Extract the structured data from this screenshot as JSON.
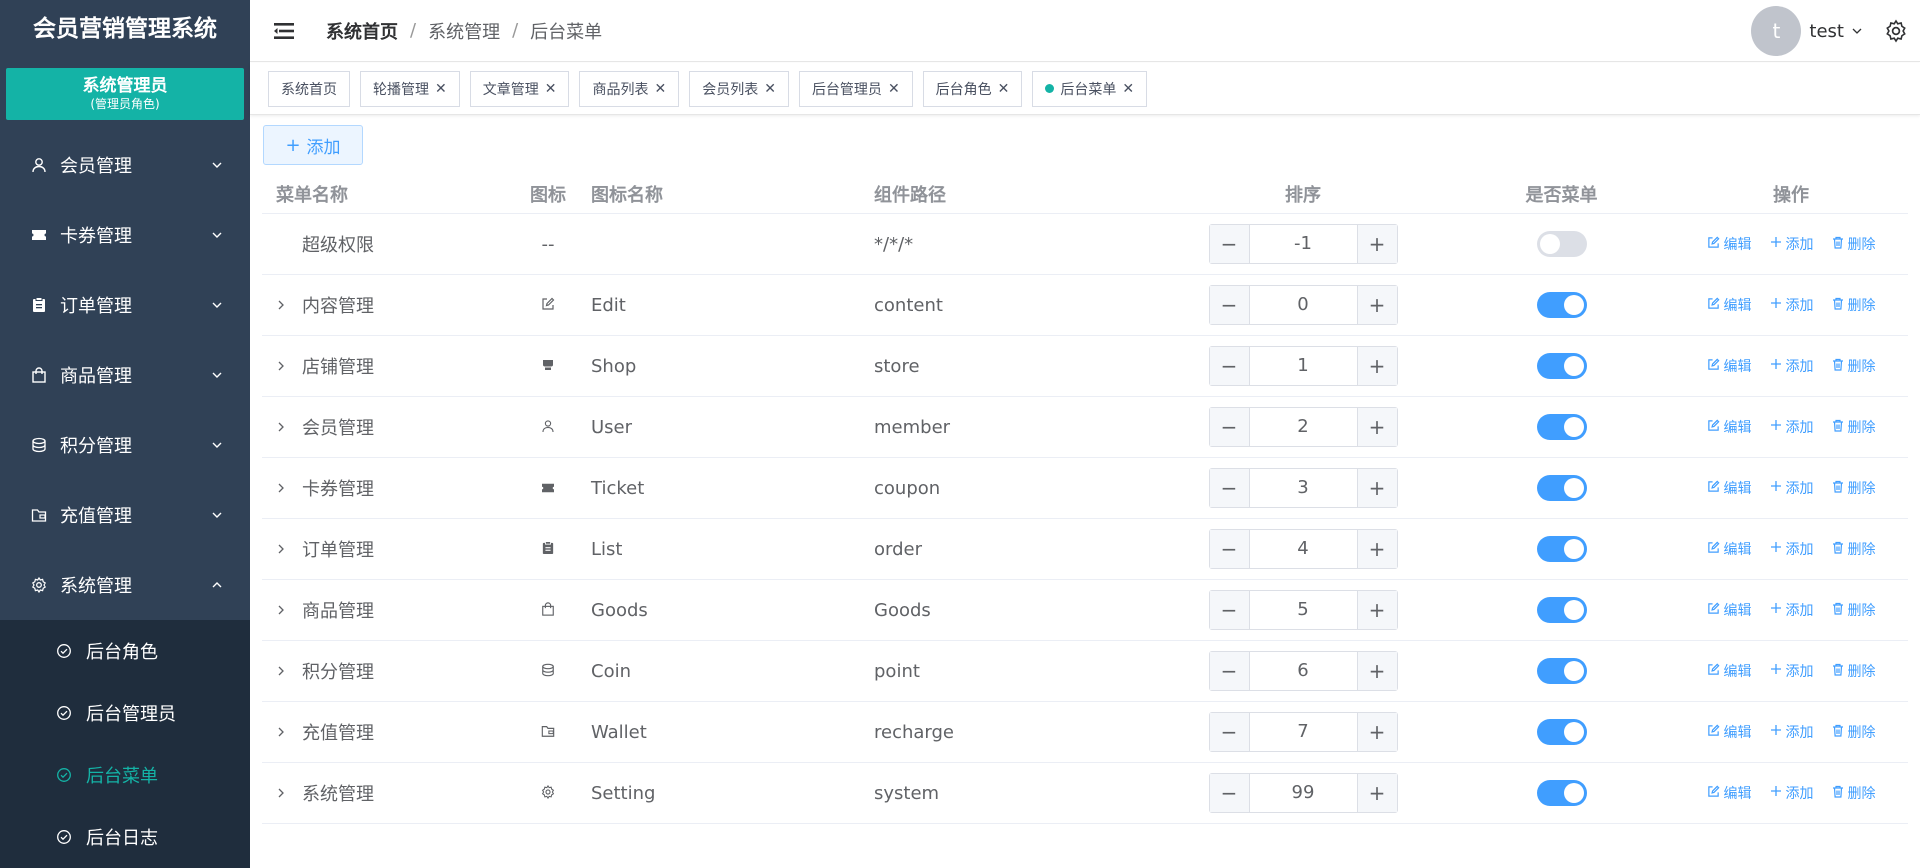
{
  "app_title": "会员营销管理系统",
  "role": {
    "name": "系统管理员",
    "sub": "(管理员角色)"
  },
  "sidebar": {
    "items": [
      {
        "label": "会员管理",
        "icon": "user-icon"
      },
      {
        "label": "卡券管理",
        "icon": "ticket-icon"
      },
      {
        "label": "订单管理",
        "icon": "list-icon"
      },
      {
        "label": "商品管理",
        "icon": "bag-icon"
      },
      {
        "label": "积分管理",
        "icon": "coin-icon"
      },
      {
        "label": "充值管理",
        "icon": "wallet-icon"
      },
      {
        "label": "系统管理",
        "icon": "gear-icon"
      }
    ],
    "subitems": [
      {
        "label": "后台角色"
      },
      {
        "label": "后台管理员"
      },
      {
        "label": "后台菜单"
      },
      {
        "label": "后台日志"
      }
    ]
  },
  "breadcrumb": [
    "系统首页",
    "系统管理",
    "后台菜单"
  ],
  "user": {
    "avatar": "t",
    "name": "test"
  },
  "tags": [
    {
      "label": "系统首页"
    },
    {
      "label": "轮播管理"
    },
    {
      "label": "文章管理"
    },
    {
      "label": "商品列表"
    },
    {
      "label": "会员列表"
    },
    {
      "label": "后台管理员"
    },
    {
      "label": "后台角色"
    },
    {
      "label": "后台菜单"
    }
  ],
  "add_button": "添加",
  "table": {
    "headers": {
      "name": "菜单名称",
      "icon": "图标",
      "icon_name": "图标名称",
      "path": "组件路径",
      "sort": "排序",
      "is_menu": "是否菜单",
      "ops": "操作"
    },
    "ops": {
      "edit": "编辑",
      "add": "添加",
      "delete": "删除"
    },
    "rows": [
      {
        "name": "超级权限",
        "icon_text": "--",
        "icon_name": "",
        "path": "*/*/*",
        "sort": "-1",
        "is_menu": false
      },
      {
        "name": "内容管理",
        "icon_name": "Edit",
        "path": "content",
        "sort": "0",
        "is_menu": true
      },
      {
        "name": "店铺管理",
        "icon_name": "Shop",
        "path": "store",
        "sort": "1",
        "is_menu": true
      },
      {
        "name": "会员管理",
        "icon_name": "User",
        "path": "member",
        "sort": "2",
        "is_menu": true
      },
      {
        "name": "卡券管理",
        "icon_name": "Ticket",
        "path": "coupon",
        "sort": "3",
        "is_menu": true
      },
      {
        "name": "订单管理",
        "icon_name": "List",
        "path": "order",
        "sort": "4",
        "is_menu": true
      },
      {
        "name": "商品管理",
        "icon_name": "Goods",
        "path": "Goods",
        "sort": "5",
        "is_menu": true
      },
      {
        "name": "积分管理",
        "icon_name": "Coin",
        "path": "point",
        "sort": "6",
        "is_menu": true
      },
      {
        "name": "充值管理",
        "icon_name": "Wallet",
        "path": "recharge",
        "sort": "7",
        "is_menu": true
      },
      {
        "name": "系统管理",
        "icon_name": "Setting",
        "path": "system",
        "sort": "99",
        "is_menu": true
      }
    ]
  },
  "colors": {
    "sidebar_bg": "#304156",
    "accent": "#14b3a6",
    "primary": "#409eff"
  }
}
